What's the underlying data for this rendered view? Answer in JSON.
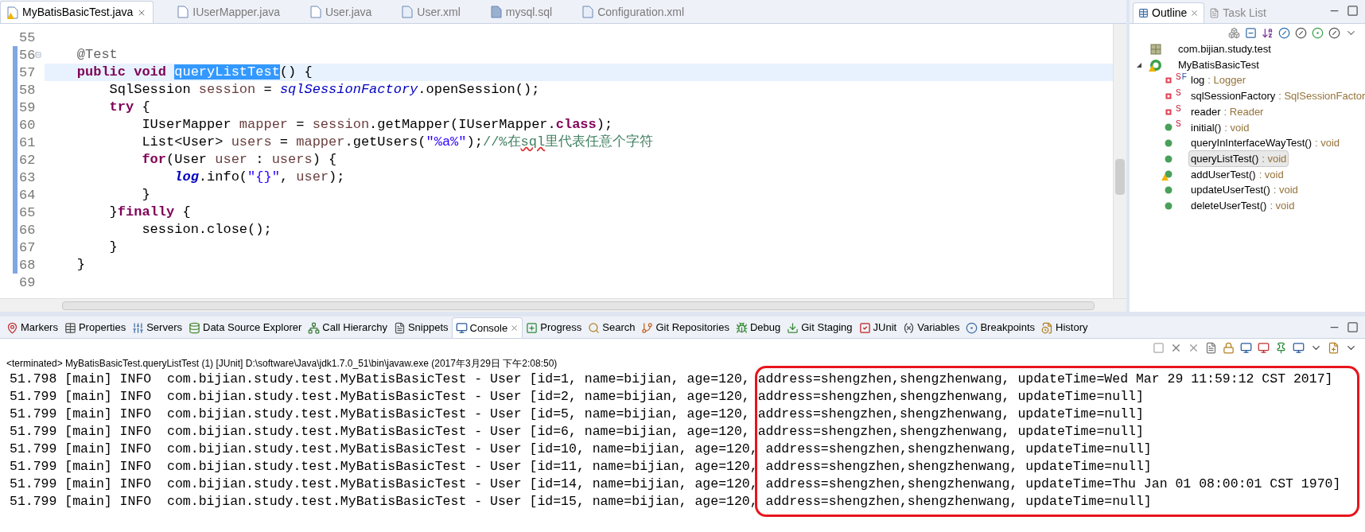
{
  "editor_tabs": [
    {
      "label": "MyBatisBasicTest.java",
      "kind": "java",
      "selected": true,
      "warning": true
    },
    {
      "label": "IUserMapper.java",
      "kind": "java",
      "selected": false,
      "warning": false
    },
    {
      "label": "User.java",
      "kind": "java",
      "selected": false,
      "warning": false
    },
    {
      "label": "User.xml",
      "kind": "xml",
      "selected": false,
      "warning": false
    },
    {
      "label": "mysql.sql",
      "kind": "sql",
      "selected": false,
      "warning": false
    },
    {
      "label": "Configuration.xml",
      "kind": "xml",
      "selected": false,
      "warning": false
    }
  ],
  "code_lines": [
    {
      "number": "55",
      "changed": false,
      "fold": false,
      "current": false
    },
    {
      "number": "56",
      "changed": true,
      "fold": true,
      "current": false,
      "tokens": [
        {
          "kind": "annotation",
          "text": "    @Test"
        }
      ]
    },
    {
      "number": "57",
      "changed": true,
      "fold": false,
      "current": true,
      "tokens": [
        {
          "kind": "keyword",
          "text": "    public void "
        },
        {
          "kind": "selected",
          "text": "queryListTest"
        },
        {
          "kind": "plain",
          "text": "() {"
        }
      ]
    },
    {
      "number": "58",
      "changed": true,
      "fold": false,
      "current": false,
      "tokens": [
        {
          "kind": "plain",
          "text": "        SqlSession "
        },
        {
          "kind": "local",
          "text": "session"
        },
        {
          "kind": "plain",
          "text": " = "
        },
        {
          "kind": "field",
          "text": "sqlSessionFactory"
        },
        {
          "kind": "plain",
          "text": ".openSession();"
        }
      ]
    },
    {
      "number": "59",
      "changed": true,
      "fold": false,
      "current": false,
      "tokens": [
        {
          "kind": "keyword",
          "text": "        try"
        },
        {
          "kind": "plain",
          "text": " {"
        }
      ]
    },
    {
      "number": "60",
      "changed": true,
      "fold": false,
      "current": false,
      "tokens": [
        {
          "kind": "plain",
          "text": "            IUserMapper "
        },
        {
          "kind": "local",
          "text": "mapper"
        },
        {
          "kind": "plain",
          "text": " = "
        },
        {
          "kind": "local",
          "text": "session"
        },
        {
          "kind": "plain",
          "text": ".getMapper(IUserMapper."
        },
        {
          "kind": "keyword",
          "text": "class"
        },
        {
          "kind": "plain",
          "text": ");"
        }
      ]
    },
    {
      "number": "61",
      "changed": true,
      "fold": false,
      "current": false,
      "tokens": [
        {
          "kind": "plain",
          "text": "            List<User> "
        },
        {
          "kind": "local",
          "text": "users"
        },
        {
          "kind": "plain",
          "text": " = "
        },
        {
          "kind": "local",
          "text": "mapper"
        },
        {
          "kind": "plain",
          "text": ".getUsers("
        },
        {
          "kind": "string",
          "text": "\"%a%\""
        },
        {
          "kind": "plain",
          "text": ");"
        },
        {
          "kind": "comment",
          "text": "//%在"
        },
        {
          "kind": "comment_misspelled",
          "text": "sql"
        },
        {
          "kind": "comment",
          "text": "里代表任意个字符"
        }
      ]
    },
    {
      "number": "62",
      "changed": true,
      "fold": false,
      "current": false,
      "tokens": [
        {
          "kind": "keyword",
          "text": "            for"
        },
        {
          "kind": "plain",
          "text": "(User "
        },
        {
          "kind": "local",
          "text": "user"
        },
        {
          "kind": "plain",
          "text": " : "
        },
        {
          "kind": "local",
          "text": "users"
        },
        {
          "kind": "plain",
          "text": ") {"
        }
      ]
    },
    {
      "number": "63",
      "changed": true,
      "fold": false,
      "current": false,
      "tokens": [
        {
          "kind": "static_field",
          "text": "                log"
        },
        {
          "kind": "plain",
          "text": ".info("
        },
        {
          "kind": "string",
          "text": "\"{}\""
        },
        {
          "kind": "plain",
          "text": ", "
        },
        {
          "kind": "local",
          "text": "user"
        },
        {
          "kind": "plain",
          "text": ");"
        }
      ]
    },
    {
      "number": "64",
      "changed": true,
      "fold": false,
      "current": false,
      "tokens": [
        {
          "kind": "plain",
          "text": "            }"
        }
      ]
    },
    {
      "number": "65",
      "changed": true,
      "fold": false,
      "current": false,
      "tokens": [
        {
          "kind": "plain",
          "text": "        }"
        },
        {
          "kind": "keyword",
          "text": "finally"
        },
        {
          "kind": "plain",
          "text": " {"
        }
      ]
    },
    {
      "number": "66",
      "changed": true,
      "fold": false,
      "current": false,
      "tokens": [
        {
          "kind": "plain",
          "text": "            session.close();"
        }
      ]
    },
    {
      "number": "67",
      "changed": true,
      "fold": false,
      "current": false,
      "tokens": [
        {
          "kind": "plain",
          "text": "        }"
        }
      ]
    },
    {
      "number": "68",
      "changed": true,
      "fold": false,
      "current": false,
      "tokens": [
        {
          "kind": "plain",
          "text": "    }"
        }
      ]
    },
    {
      "number": "69",
      "changed": false,
      "fold": false,
      "current": false
    }
  ],
  "outline": {
    "tabs": [
      {
        "label": "Outline",
        "selected": true
      },
      {
        "label": "Task List",
        "selected": false
      }
    ],
    "tree": [
      {
        "name": "com.bijian.study.test",
        "kind": "package",
        "selected": false,
        "warning": false
      },
      {
        "name": "MyBatisBasicTest",
        "kind": "class",
        "selected": false,
        "warning": true,
        "expanded": true,
        "children": [
          {
            "name": "log",
            "type": ": Logger",
            "kind": "field",
            "static_mark": "S",
            "final_mark": "F",
            "selected": false,
            "warning": false
          },
          {
            "name": "sqlSessionFactory",
            "type": ": SqlSessionFactor",
            "kind": "field",
            "static_mark": "S",
            "selected": false,
            "warning": false
          },
          {
            "name": "reader",
            "type": ": Reader",
            "kind": "field",
            "static_mark": "S",
            "selected": false,
            "warning": false
          },
          {
            "name": "initial()",
            "type": ": void",
            "kind": "method",
            "static_mark": "S",
            "selected": false,
            "warning": false
          },
          {
            "name": "queryInInterfaceWayTest()",
            "type": ": void",
            "kind": "method",
            "selected": false,
            "warning": false
          },
          {
            "name": "queryListTest()",
            "type": ": void",
            "kind": "method",
            "selected": true,
            "warning": false
          },
          {
            "name": "addUserTest()",
            "type": ": void",
            "kind": "method",
            "selected": false,
            "warning": true
          },
          {
            "name": "updateUserTest()",
            "type": ": void",
            "kind": "method",
            "selected": false,
            "warning": false
          },
          {
            "name": "deleteUserTest()",
            "type": ": void",
            "kind": "method",
            "selected": false,
            "warning": false
          }
        ]
      }
    ]
  },
  "bottom_tabs": [
    {
      "label": "Markers",
      "kind": "markers",
      "selected": false
    },
    {
      "label": "Properties",
      "kind": "properties",
      "selected": false
    },
    {
      "label": "Servers",
      "kind": "servers",
      "selected": false
    },
    {
      "label": "Data Source Explorer",
      "kind": "datasource",
      "selected": false
    },
    {
      "label": "Call Hierarchy",
      "kind": "hierarchy",
      "selected": false
    },
    {
      "label": "Snippets",
      "kind": "snippets",
      "selected": false
    },
    {
      "label": "Console",
      "kind": "console",
      "selected": true
    },
    {
      "label": "Progress",
      "kind": "progress",
      "selected": false
    },
    {
      "label": "Search",
      "kind": "search",
      "selected": false
    },
    {
      "label": "Git Repositories",
      "kind": "git",
      "selected": false
    },
    {
      "label": "Debug",
      "kind": "debug",
      "selected": false
    },
    {
      "label": "Git Staging",
      "kind": "staging",
      "selected": false
    },
    {
      "label": "JUnit",
      "kind": "junit",
      "selected": false
    },
    {
      "label": "Variables",
      "kind": "variables",
      "selected": false
    },
    {
      "label": "Breakpoints",
      "kind": "breakpoints",
      "selected": false
    },
    {
      "label": "History",
      "kind": "history",
      "selected": false
    }
  ],
  "console": {
    "header": "<terminated> MyBatisBasicTest.queryListTest (1) [JUnit] D:\\software\\Java\\jdk1.7.0_51\\bin\\javaw.exe (2017年3月29日 下午2:08:50)",
    "lines": [
      "51.798 [main] INFO  com.bijian.study.test.MyBatisBasicTest - User [id=1, name=bijian, age=120, address=shengzhen,shengzhenwang, updateTime=Wed Mar 29 11:59:12 CST 2017]",
      "51.799 [main] INFO  com.bijian.study.test.MyBatisBasicTest - User [id=2, name=bijian, age=120, address=shengzhen,shengzhenwang, updateTime=null]",
      "51.799 [main] INFO  com.bijian.study.test.MyBatisBasicTest - User [id=5, name=bijian, age=120, address=shengzhen,shengzhenwang, updateTime=null]",
      "51.799 [main] INFO  com.bijian.study.test.MyBatisBasicTest - User [id=6, name=bijian, age=120, address=shengzhen,shengzhenwang, updateTime=null]",
      "51.799 [main] INFO  com.bijian.study.test.MyBatisBasicTest - User [id=10, name=bijian, age=120, address=shengzhen,shengzhenwang, updateTime=null]",
      "51.799 [main] INFO  com.bijian.study.test.MyBatisBasicTest - User [id=11, name=bijian, age=120, address=shengzhen,shengzhenwang, updateTime=null]",
      "51.799 [main] INFO  com.bijian.study.test.MyBatisBasicTest - User [id=14, name=bijian, age=120, address=shengzhen,shengzhenwang, updateTime=Thu Jan 01 08:00:01 CST 1970]",
      "51.799 [main] INFO  com.bijian.study.test.MyBatisBasicTest - User [id=15, name=bijian, age=120, address=shengzhen,shengzhenwang, updateTime=null]"
    ]
  }
}
